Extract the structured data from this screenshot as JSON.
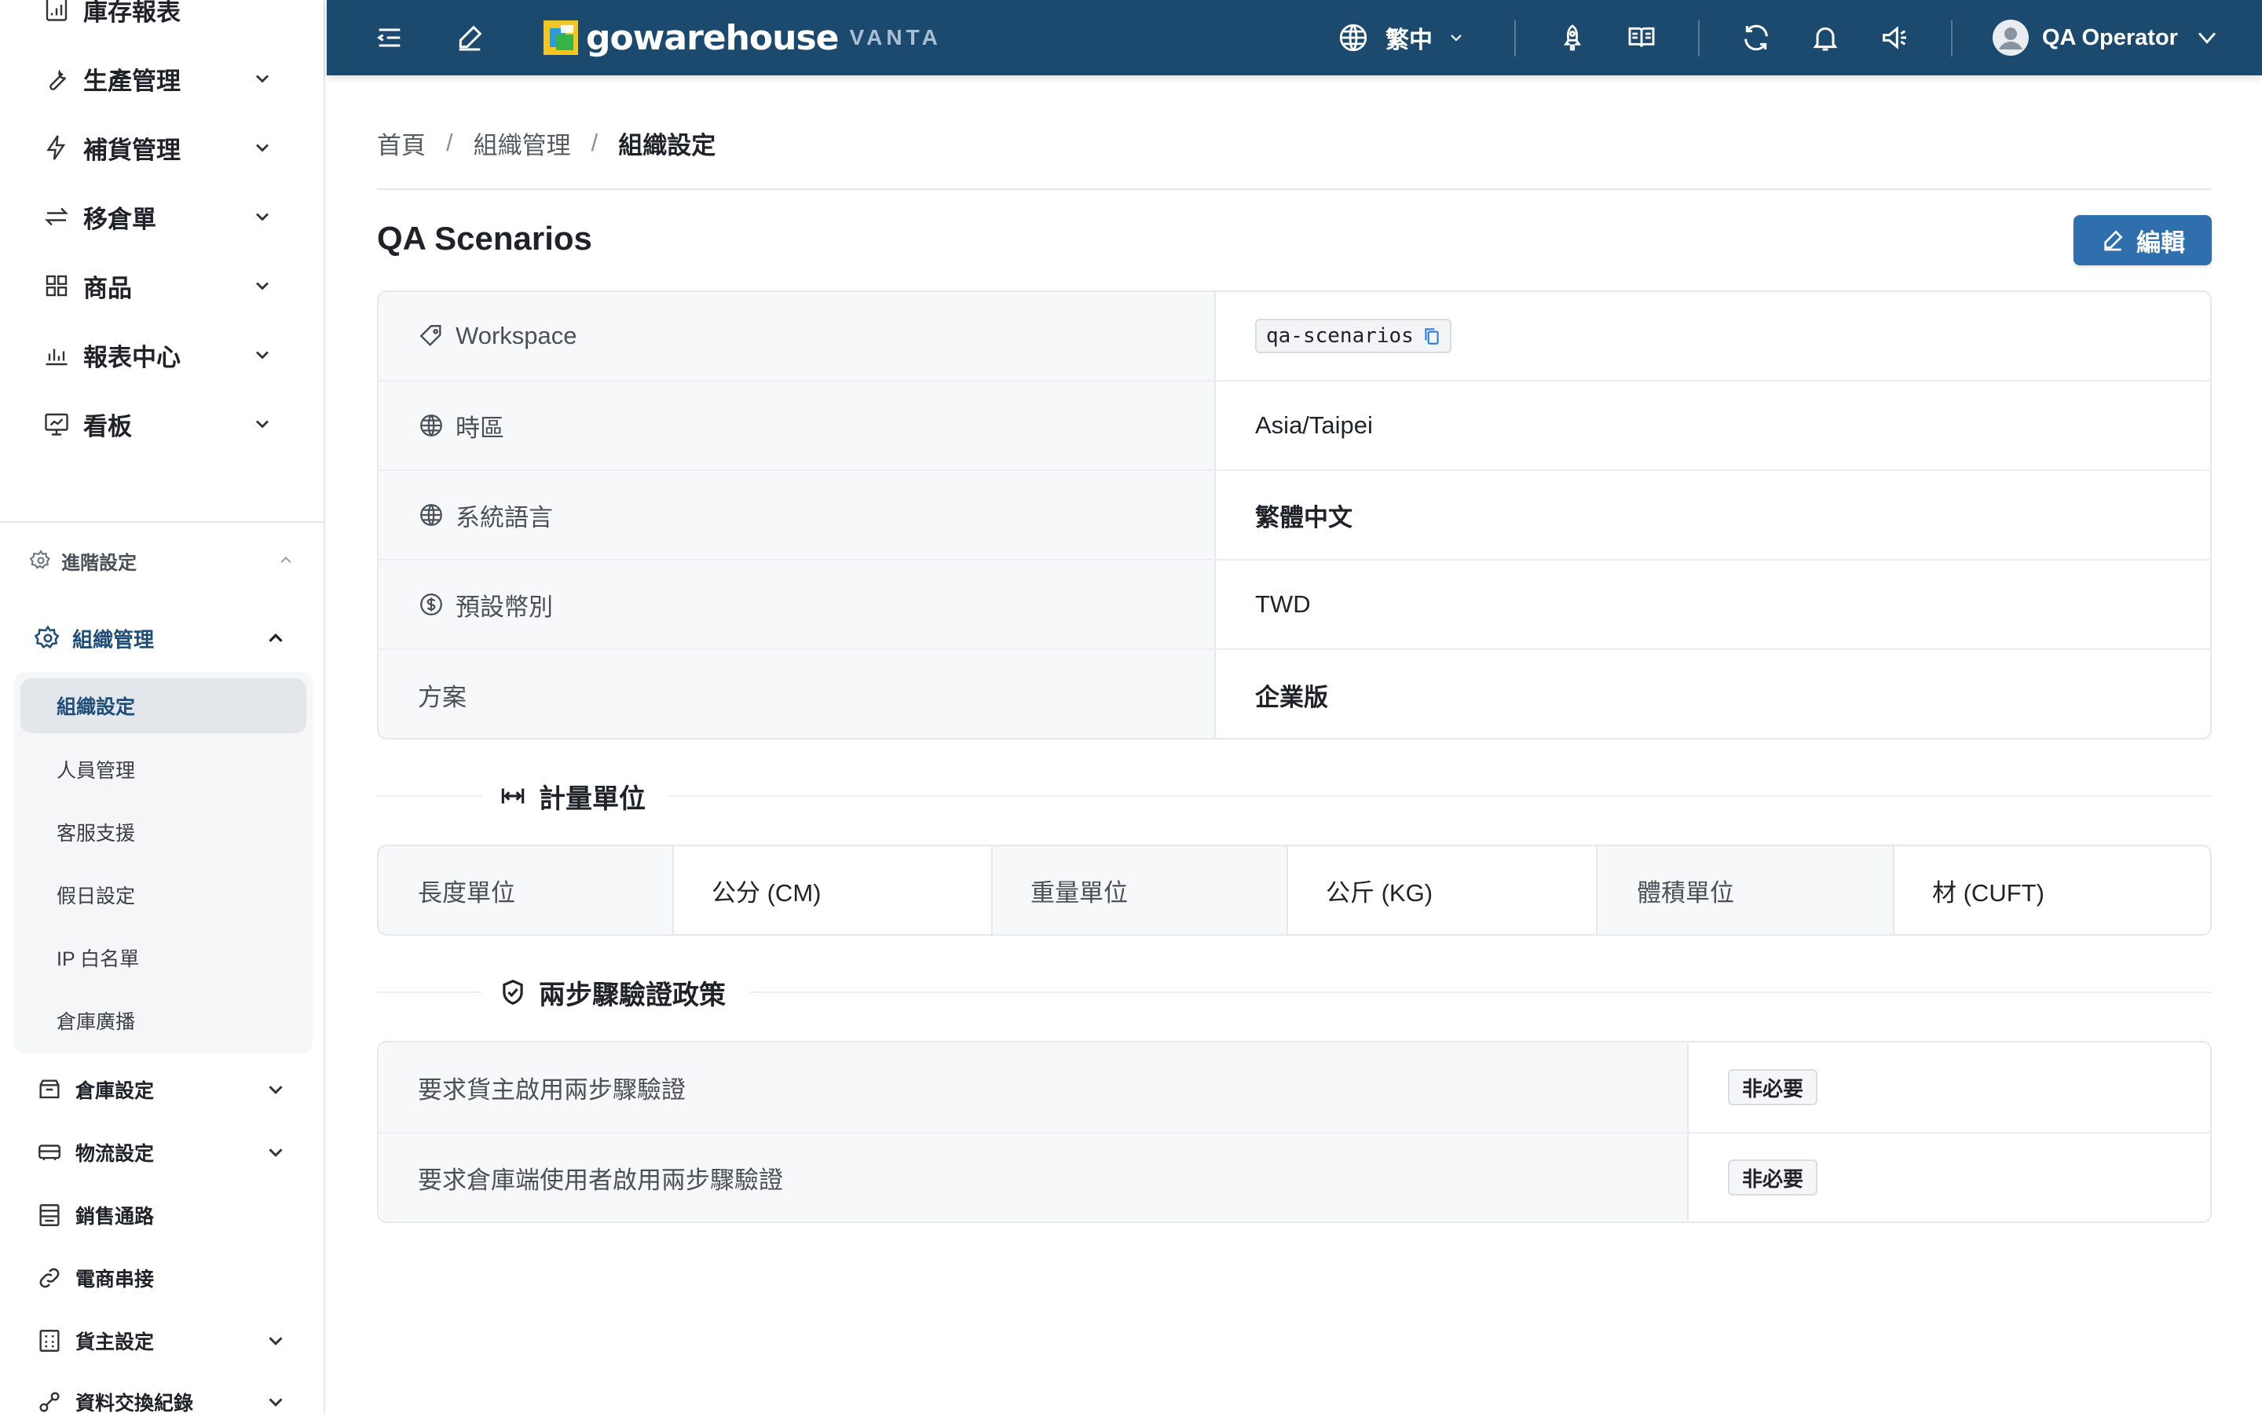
{
  "sidebar": {
    "top_items": [
      {
        "label": "庫存報表",
        "icon": "chart-report-icon"
      },
      {
        "label": "生產管理",
        "icon": "wrench-icon"
      },
      {
        "label": "補貨管理",
        "icon": "lightning-icon"
      },
      {
        "label": "移倉單",
        "icon": "transfer-arrows-icon"
      },
      {
        "label": "商品",
        "icon": "grid-icon"
      },
      {
        "label": "報表中心",
        "icon": "bar-chart-icon"
      },
      {
        "label": "看板",
        "icon": "dashboard-icon"
      }
    ],
    "section": {
      "label": "進階設定",
      "icon": "gear-icon"
    },
    "group": {
      "label": "組織管理",
      "icon": "gear-icon",
      "items": [
        {
          "label": "組織設定",
          "active": true
        },
        {
          "label": "人員管理"
        },
        {
          "label": "客服支援"
        },
        {
          "label": "假日設定"
        },
        {
          "label": "IP 白名單"
        },
        {
          "label": "倉庫廣播"
        }
      ]
    },
    "lower_items": [
      {
        "label": "倉庫設定",
        "icon": "warehouse-box-icon",
        "expandable": true
      },
      {
        "label": "物流設定",
        "icon": "truck-icon",
        "expandable": true
      },
      {
        "label": "銷售通路",
        "icon": "storefront-icon",
        "expandable": false
      },
      {
        "label": "電商串接",
        "icon": "link-icon",
        "expandable": false
      },
      {
        "label": "貨主設定",
        "icon": "calculator-icon",
        "expandable": true
      },
      {
        "label": "資料交換紀錄",
        "icon": "exchange-icon",
        "expandable": true
      }
    ]
  },
  "topbar": {
    "logo_text": "gowarehouse",
    "logo_sub": "VANTA",
    "language": "繁中",
    "user_name": "QA Operator"
  },
  "breadcrumb": {
    "home": "首頁",
    "parent": "組織管理",
    "current": "組織設定",
    "separator": "/"
  },
  "page": {
    "title": "QA Scenarios",
    "edit_label": "編輯"
  },
  "info": {
    "rows": [
      {
        "label": "Workspace",
        "icon": "tag-icon",
        "value": "qa-scenarios"
      },
      {
        "label": "時區",
        "icon": "globe-icon",
        "value": "Asia/Taipei"
      },
      {
        "label": "系統語言",
        "icon": "globe-icon",
        "value": "繁體中文"
      },
      {
        "label": "預設幣別",
        "icon": "dollar-circle-icon",
        "value": "TWD"
      },
      {
        "label": "方案",
        "icon": "",
        "value": "企業版"
      }
    ]
  },
  "units": {
    "title": "計量單位",
    "length_label": "長度單位",
    "length_value": "公分 (CM)",
    "weight_label": "重量單位",
    "weight_value": "公斤 (KG)",
    "volume_label": "體積單位",
    "volume_value": "材 (CUFT)"
  },
  "two_factor": {
    "title": "兩步驟驗證政策",
    "rows": [
      {
        "label": "要求貨主啟用兩步驟驗證",
        "value": "非必要"
      },
      {
        "label": "要求倉庫端使用者啟用兩步驟驗證",
        "value": "非必要"
      }
    ]
  },
  "colors": {
    "topbar_bg": "#1c4a6e",
    "primary_button": "#2f6fae",
    "active_text": "#1f4e79"
  }
}
